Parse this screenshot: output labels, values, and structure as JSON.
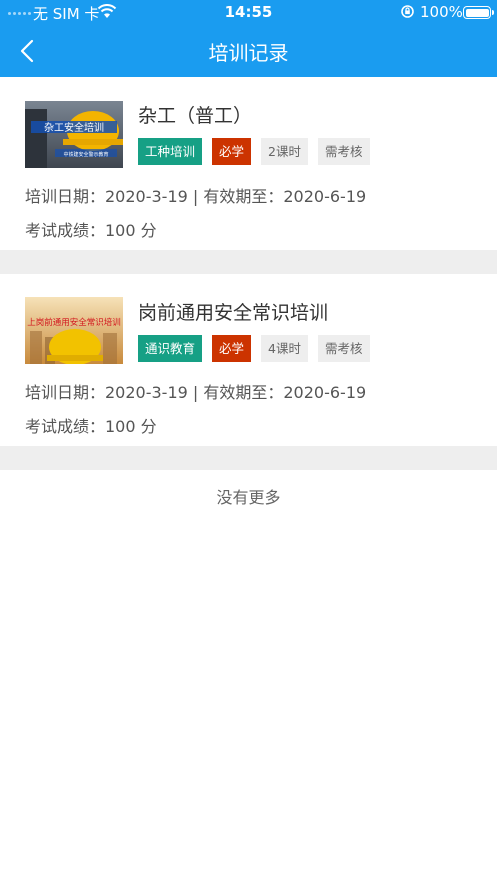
{
  "status_bar": {
    "carrier": "无 SIM 卡",
    "time": "14:55",
    "battery": "100%"
  },
  "nav": {
    "title": "培训记录"
  },
  "records": [
    {
      "thumb_title": "杂工安全培训",
      "thumb_sub": "中铁建安全警示教育",
      "title": "杂工（普工）",
      "tag_type": "工种培训",
      "tag_required": "必学",
      "tag_hours": "2课时",
      "tag_exam": "需考核",
      "date_line": "培训日期：2020-3-19 | 有效期至：2020-6-19",
      "score_line": "考试成绩：100 分"
    },
    {
      "thumb_title": "上岗前通用安全常识培训",
      "thumb_sub": "",
      "title": "岗前通用安全常识培训",
      "tag_type": "通识教育",
      "tag_required": "必学",
      "tag_hours": "4课时",
      "tag_exam": "需考核",
      "date_line": "培训日期：2020-3-19 | 有效期至：2020-6-19",
      "score_line": "考试成绩：100 分"
    }
  ],
  "footer": {
    "no_more": "没有更多"
  },
  "colors": {
    "primary": "#1a9cf0",
    "tag_teal": "#16a085",
    "tag_red": "#cc3300",
    "tag_grey": "#eeeeee",
    "separator": "#eeeeee"
  }
}
